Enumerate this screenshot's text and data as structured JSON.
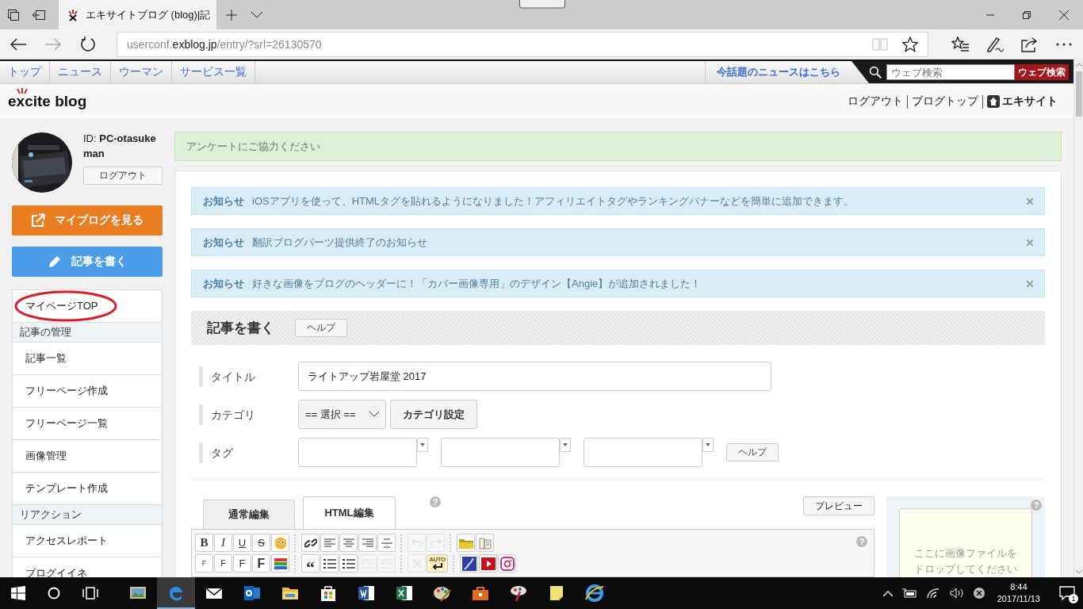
{
  "browser": {
    "tab_title": "エキサイトブログ (blog)|記",
    "url": {
      "prefix": "userconf.",
      "domain": "exblog.jp",
      "path": "/entry/?srl=26130570"
    },
    "forward_disabled": true
  },
  "site_nav": {
    "items": [
      "トップ",
      "ニュース",
      "ウーマン",
      "サービス一覧"
    ],
    "news_link": "今話題のニュースはこちら",
    "search_placeholder": "ウェブ検索",
    "search_button": "ウェブ検索"
  },
  "header": {
    "logo": "excite blog",
    "links": [
      "ログアウト",
      "ブログトップ",
      "エキサイト"
    ]
  },
  "profile": {
    "id_text": "ID: **PC-otasukeman**",
    "logout": "ログアウト"
  },
  "actions": {
    "view_blog": "マイブログを見る",
    "write": "記事を書く"
  },
  "menu": [
    {
      "kind": "item",
      "label": "マイページTOP",
      "circled": true
    },
    {
      "kind": "header",
      "label": "記事の管理"
    },
    {
      "kind": "item",
      "label": "記事一覧",
      "circled": false
    },
    {
      "kind": "item",
      "label": "フリーページ作成",
      "circled": false
    },
    {
      "kind": "item",
      "label": "フリーページ一覧",
      "circled": false
    },
    {
      "kind": "item",
      "label": "画像管理",
      "circled": false
    },
    {
      "kind": "item",
      "label": "テンプレート作成",
      "circled": false
    },
    {
      "kind": "header",
      "label": "リアクション"
    },
    {
      "kind": "item",
      "label": "アクセスレポート",
      "circled": false
    },
    {
      "kind": "item",
      "label": "ブログイイネ",
      "circled": false
    }
  ],
  "survey": "アンケートにご協力ください",
  "notices": [
    {
      "label": "お知らせ",
      "text": "iOSアプリを使って、HTMLタグを貼れるようになりました！アフィリエイトタグやランキングバナーなどを簡単に追加できます。"
    },
    {
      "label": "お知らせ",
      "text": "翻訳ブログパーツ提供終了のお知らせ"
    },
    {
      "label": "お知らせ",
      "text": "好きな画像をブログのヘッダーに！「カバー画像専用」のデザイン【Angie】が追加されました！"
    }
  ],
  "editor": {
    "title": "記事を書く",
    "help": "ヘルプ",
    "form": {
      "title_label": "タイトル",
      "title_value": "ライトアップ岩屋堂 2017",
      "category_label": "カテゴリ",
      "category_value": "== 選択 ==",
      "category_button": "カテゴリ設定",
      "tag_label": "タグ",
      "tag_help": "ヘルプ"
    },
    "tabs": [
      {
        "label": "通常編集",
        "selected": false
      },
      {
        "label": "HTML編集",
        "selected": true
      }
    ],
    "tabs_help": "?",
    "preview": "プレビュー",
    "toolbar_help": "?",
    "toolbar": [
      [
        [
          {
            "kind": "bold",
            "label": "B",
            "disabled": false
          },
          {
            "kind": "italic",
            "label": "I",
            "disabled": false
          },
          {
            "kind": "underline",
            "label": "U",
            "disabled": false
          },
          {
            "kind": "strike",
            "label": "S",
            "disabled": false
          },
          {
            "kind": "emoji",
            "disabled": false
          }
        ],
        [
          {
            "kind": "link",
            "disabled": false
          },
          {
            "kind": "align-left",
            "disabled": false
          },
          {
            "kind": "align-center",
            "disabled": false
          },
          {
            "kind": "align-right",
            "disabled": false
          },
          {
            "kind": "rule",
            "disabled": false
          }
        ],
        [
          {
            "kind": "undo",
            "disabled": true
          },
          {
            "kind": "redo",
            "disabled": true
          }
        ],
        [
          {
            "kind": "folder",
            "disabled": false
          },
          {
            "kind": "book",
            "disabled": false
          }
        ]
      ],
      [
        [
          {
            "kind": "font-xs",
            "label": "F",
            "disabled": false
          },
          {
            "kind": "font-s",
            "label": "F",
            "disabled": false
          },
          {
            "kind": "font-m",
            "label": "F",
            "disabled": false
          },
          {
            "kind": "font-l",
            "label": "F",
            "disabled": false
          },
          {
            "kind": "color",
            "disabled": false
          }
        ],
        [
          {
            "kind": "quote",
            "label": "“",
            "disabled": false
          },
          {
            "kind": "bullets",
            "disabled": false
          },
          {
            "kind": "numbers",
            "disabled": false
          },
          {
            "kind": "indent",
            "disabled": true
          },
          {
            "kind": "outdent",
            "disabled": true
          }
        ],
        [
          {
            "kind": "clear",
            "disabled": true
          },
          {
            "kind": "auto",
            "label": "AUTO",
            "disabled": false
          }
        ],
        [
          {
            "kind": "map",
            "disabled": false
          },
          {
            "kind": "video",
            "disabled": false
          },
          {
            "kind": "camera",
            "disabled": false
          }
        ]
      ]
    ],
    "dropzone": {
      "help": "?",
      "text": "ここに画像ファイルをドロップしてください"
    }
  },
  "taskbar": {
    "apps": [
      {
        "selected": false
      },
      {
        "selected": true
      },
      {
        "selected": false
      },
      {
        "selected": false
      },
      {
        "selected": false
      },
      {
        "selected": false
      },
      {
        "selected": false
      },
      {
        "selected": false
      },
      {
        "selected": false
      },
      {
        "selected": false
      },
      {
        "selected": false
      },
      {
        "selected": false
      },
      {
        "selected": false
      }
    ],
    "time": "8:44",
    "date": "2017/11/13",
    "notifications": "1"
  }
}
